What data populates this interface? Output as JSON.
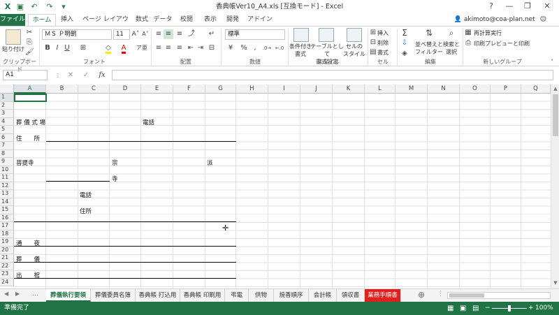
{
  "window": {
    "title": "香典帳Ver10_A4.xls [互換モード] - Excel",
    "help": "?",
    "minimize": "—",
    "restore": "❐",
    "close": "✕"
  },
  "tabs": [
    "ファイル",
    "ホーム",
    "挿入",
    "ページ レイアウト",
    "数式",
    "データ",
    "校閲",
    "表示",
    "開発",
    "アドイン"
  ],
  "account": "akimoto@coa-plan.net",
  "ribbon": {
    "clipboard": {
      "paste": "貼り付け",
      "label": "クリップボード"
    },
    "font": {
      "name": "ＭＳ Ｐ明朝",
      "size": "11",
      "label": "フォント"
    },
    "alignment": {
      "label": "配置"
    },
    "number": {
      "format": "標準",
      "label": "数値"
    },
    "styles": {
      "conditional": "条件付き\n書式",
      "table": "テーブルとして\n書式設定",
      "cell": "セルの\nスタイル",
      "label": "スタイル"
    },
    "cells": {
      "insert": "挿入",
      "delete": "削除",
      "format": "書式",
      "label": "セル"
    },
    "editing": {
      "sort": "並べ替えと\nフィルター",
      "find": "検索と\n選択",
      "label": "編集"
    },
    "newgroup": {
      "recalc": "再計算実行",
      "print_preview": "印刷プレビューと印刷",
      "label": "新しいグループ"
    }
  },
  "formula_bar": {
    "name_box": "A1",
    "value": ""
  },
  "columns": [
    "A",
    "B",
    "C",
    "D",
    "E",
    "F",
    "G",
    "H",
    "I",
    "J",
    "K",
    "L",
    "M",
    "N",
    "O",
    "P",
    "Q"
  ],
  "rows": [
    "1",
    "2",
    "3",
    "4",
    "5",
    "6",
    "7",
    "8",
    "9",
    "10",
    "11",
    "12",
    "13",
    "14",
    "15",
    "16",
    "17",
    "18",
    "19",
    "20",
    "21",
    "22",
    "23",
    "24"
  ],
  "cells": {
    "a4": "葬 儀 式 場",
    "e4": "電話",
    "a6": "住　　所",
    "a9": "菩提寺",
    "d9": "宗",
    "g9": "派",
    "d11": "寺",
    "c13": "電話",
    "c15": "住所",
    "a19": "通　　夜",
    "a21": "葬　　儀",
    "a23": "出　　棺"
  },
  "sheets": [
    "葬儀執行要領",
    "葬儀委員名簿",
    "香典帳 打込用",
    "香典帳 印刷用",
    "弔電",
    "供物",
    "焼香順序",
    "会計帳",
    "領収書",
    "業務手順書"
  ],
  "status": {
    "ready": "準備完了",
    "zoom": "100%"
  }
}
